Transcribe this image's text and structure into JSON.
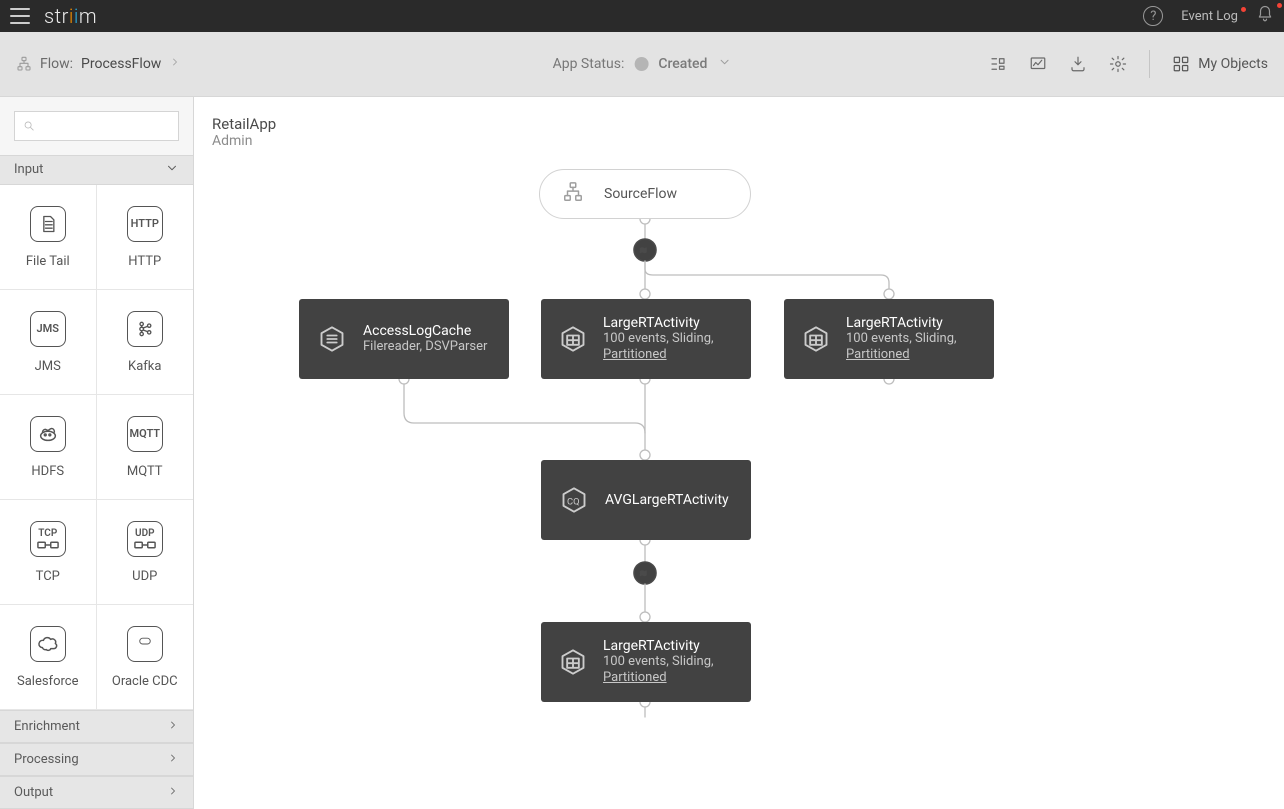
{
  "header": {
    "brand": "striim",
    "event_log_label": "Event Log"
  },
  "subbar": {
    "flow_prefix": "Flow:",
    "flow_name": "ProcessFlow",
    "status_prefix": "App Status:",
    "status_value": "Created",
    "my_objects_label": "My Objects"
  },
  "sidebar": {
    "search_placeholder": "",
    "sections": {
      "input_label": "Input",
      "enrichment_label": "Enrichment",
      "processing_label": "Processing",
      "output_label": "Output"
    },
    "palette": [
      {
        "name": "file-tail",
        "label": "File Tail",
        "icon_text": ""
      },
      {
        "name": "http",
        "label": "HTTP",
        "icon_text": "HTTP"
      },
      {
        "name": "jms",
        "label": "JMS",
        "icon_text": "JMS"
      },
      {
        "name": "kafka",
        "label": "Kafka",
        "icon_text": ""
      },
      {
        "name": "hdfs",
        "label": "HDFS",
        "icon_text": ""
      },
      {
        "name": "mqtt",
        "label": "MQTT",
        "icon_text": "MQTT"
      },
      {
        "name": "tcp",
        "label": "TCP",
        "icon_text": "TCP"
      },
      {
        "name": "udp",
        "label": "UDP",
        "icon_text": "UDP"
      },
      {
        "name": "salesforce",
        "label": "Salesforce",
        "icon_text": ""
      },
      {
        "name": "oracle-cdc",
        "label": "Oracle CDC",
        "icon_text": ""
      }
    ]
  },
  "app": {
    "title": "RetailApp",
    "owner": "Admin"
  },
  "nodes": {
    "sourceflow": {
      "title": "SourceFlow"
    },
    "accesslog": {
      "title": "AccessLogCache",
      "sub": "Filereader, DSVParser"
    },
    "large1": {
      "title": "LargeRTActivity",
      "sub": "100 events, Sliding,",
      "link": "Partitioned"
    },
    "large2": {
      "title": "LargeRTActivity",
      "sub": "100 events, Sliding,",
      "link": "Partitioned"
    },
    "avg": {
      "title": "AVGLargeRTActivity"
    },
    "large3": {
      "title": "LargeRTActivity",
      "sub": "100 events, Sliding,",
      "link": "Partitioned"
    }
  }
}
